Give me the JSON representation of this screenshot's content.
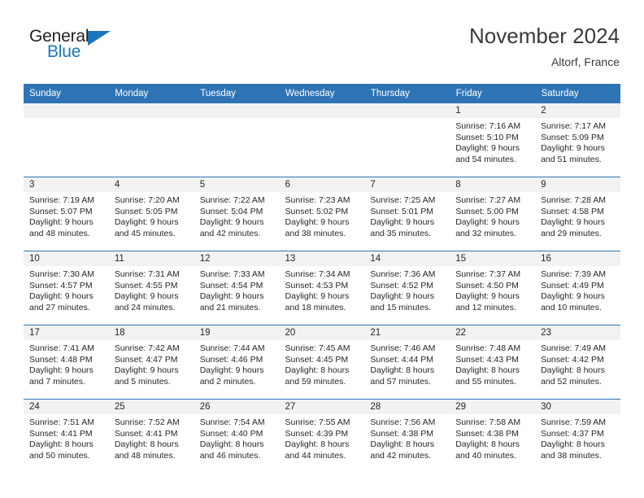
{
  "brand": {
    "name_top": "General",
    "name_bottom": "Blue",
    "triangle_icon": "triangle-icon",
    "color_blue": "#1b75bc",
    "color_dark": "#231f20"
  },
  "header": {
    "title": "November 2024",
    "location": "Altorf, France"
  },
  "theme": {
    "header_blue": "#2e74b5",
    "daynum_band": "#f2f2f2",
    "text": "#262626"
  },
  "weekdays": [
    "Sunday",
    "Monday",
    "Tuesday",
    "Wednesday",
    "Thursday",
    "Friday",
    "Saturday"
  ],
  "labels": {
    "sunrise_prefix": "Sunrise:",
    "sunset_prefix": "Sunset:",
    "daylight_prefix": "Daylight:"
  },
  "weeks": [
    [
      {
        "day": "",
        "sunrise": "",
        "sunset": "",
        "daylight_line1": "",
        "daylight_line2": ""
      },
      {
        "day": "",
        "sunrise": "",
        "sunset": "",
        "daylight_line1": "",
        "daylight_line2": ""
      },
      {
        "day": "",
        "sunrise": "",
        "sunset": "",
        "daylight_line1": "",
        "daylight_line2": ""
      },
      {
        "day": "",
        "sunrise": "",
        "sunset": "",
        "daylight_line1": "",
        "daylight_line2": ""
      },
      {
        "day": "",
        "sunrise": "",
        "sunset": "",
        "daylight_line1": "",
        "daylight_line2": ""
      },
      {
        "day": "1",
        "sunrise": "Sunrise: 7:16 AM",
        "sunset": "Sunset: 5:10 PM",
        "daylight_line1": "Daylight: 9 hours",
        "daylight_line2": "and 54 minutes."
      },
      {
        "day": "2",
        "sunrise": "Sunrise: 7:17 AM",
        "sunset": "Sunset: 5:09 PM",
        "daylight_line1": "Daylight: 9 hours",
        "daylight_line2": "and 51 minutes."
      }
    ],
    [
      {
        "day": "3",
        "sunrise": "Sunrise: 7:19 AM",
        "sunset": "Sunset: 5:07 PM",
        "daylight_line1": "Daylight: 9 hours",
        "daylight_line2": "and 48 minutes."
      },
      {
        "day": "4",
        "sunrise": "Sunrise: 7:20 AM",
        "sunset": "Sunset: 5:05 PM",
        "daylight_line1": "Daylight: 9 hours",
        "daylight_line2": "and 45 minutes."
      },
      {
        "day": "5",
        "sunrise": "Sunrise: 7:22 AM",
        "sunset": "Sunset: 5:04 PM",
        "daylight_line1": "Daylight: 9 hours",
        "daylight_line2": "and 42 minutes."
      },
      {
        "day": "6",
        "sunrise": "Sunrise: 7:23 AM",
        "sunset": "Sunset: 5:02 PM",
        "daylight_line1": "Daylight: 9 hours",
        "daylight_line2": "and 38 minutes."
      },
      {
        "day": "7",
        "sunrise": "Sunrise: 7:25 AM",
        "sunset": "Sunset: 5:01 PM",
        "daylight_line1": "Daylight: 9 hours",
        "daylight_line2": "and 35 minutes."
      },
      {
        "day": "8",
        "sunrise": "Sunrise: 7:27 AM",
        "sunset": "Sunset: 5:00 PM",
        "daylight_line1": "Daylight: 9 hours",
        "daylight_line2": "and 32 minutes."
      },
      {
        "day": "9",
        "sunrise": "Sunrise: 7:28 AM",
        "sunset": "Sunset: 4:58 PM",
        "daylight_line1": "Daylight: 9 hours",
        "daylight_line2": "and 29 minutes."
      }
    ],
    [
      {
        "day": "10",
        "sunrise": "Sunrise: 7:30 AM",
        "sunset": "Sunset: 4:57 PM",
        "daylight_line1": "Daylight: 9 hours",
        "daylight_line2": "and 27 minutes."
      },
      {
        "day": "11",
        "sunrise": "Sunrise: 7:31 AM",
        "sunset": "Sunset: 4:55 PM",
        "daylight_line1": "Daylight: 9 hours",
        "daylight_line2": "and 24 minutes."
      },
      {
        "day": "12",
        "sunrise": "Sunrise: 7:33 AM",
        "sunset": "Sunset: 4:54 PM",
        "daylight_line1": "Daylight: 9 hours",
        "daylight_line2": "and 21 minutes."
      },
      {
        "day": "13",
        "sunrise": "Sunrise: 7:34 AM",
        "sunset": "Sunset: 4:53 PM",
        "daylight_line1": "Daylight: 9 hours",
        "daylight_line2": "and 18 minutes."
      },
      {
        "day": "14",
        "sunrise": "Sunrise: 7:36 AM",
        "sunset": "Sunset: 4:52 PM",
        "daylight_line1": "Daylight: 9 hours",
        "daylight_line2": "and 15 minutes."
      },
      {
        "day": "15",
        "sunrise": "Sunrise: 7:37 AM",
        "sunset": "Sunset: 4:50 PM",
        "daylight_line1": "Daylight: 9 hours",
        "daylight_line2": "and 12 minutes."
      },
      {
        "day": "16",
        "sunrise": "Sunrise: 7:39 AM",
        "sunset": "Sunset: 4:49 PM",
        "daylight_line1": "Daylight: 9 hours",
        "daylight_line2": "and 10 minutes."
      }
    ],
    [
      {
        "day": "17",
        "sunrise": "Sunrise: 7:41 AM",
        "sunset": "Sunset: 4:48 PM",
        "daylight_line1": "Daylight: 9 hours",
        "daylight_line2": "and 7 minutes."
      },
      {
        "day": "18",
        "sunrise": "Sunrise: 7:42 AM",
        "sunset": "Sunset: 4:47 PM",
        "daylight_line1": "Daylight: 9 hours",
        "daylight_line2": "and 5 minutes."
      },
      {
        "day": "19",
        "sunrise": "Sunrise: 7:44 AM",
        "sunset": "Sunset: 4:46 PM",
        "daylight_line1": "Daylight: 9 hours",
        "daylight_line2": "and 2 minutes."
      },
      {
        "day": "20",
        "sunrise": "Sunrise: 7:45 AM",
        "sunset": "Sunset: 4:45 PM",
        "daylight_line1": "Daylight: 8 hours",
        "daylight_line2": "and 59 minutes."
      },
      {
        "day": "21",
        "sunrise": "Sunrise: 7:46 AM",
        "sunset": "Sunset: 4:44 PM",
        "daylight_line1": "Daylight: 8 hours",
        "daylight_line2": "and 57 minutes."
      },
      {
        "day": "22",
        "sunrise": "Sunrise: 7:48 AM",
        "sunset": "Sunset: 4:43 PM",
        "daylight_line1": "Daylight: 8 hours",
        "daylight_line2": "and 55 minutes."
      },
      {
        "day": "23",
        "sunrise": "Sunrise: 7:49 AM",
        "sunset": "Sunset: 4:42 PM",
        "daylight_line1": "Daylight: 8 hours",
        "daylight_line2": "and 52 minutes."
      }
    ],
    [
      {
        "day": "24",
        "sunrise": "Sunrise: 7:51 AM",
        "sunset": "Sunset: 4:41 PM",
        "daylight_line1": "Daylight: 8 hours",
        "daylight_line2": "and 50 minutes."
      },
      {
        "day": "25",
        "sunrise": "Sunrise: 7:52 AM",
        "sunset": "Sunset: 4:41 PM",
        "daylight_line1": "Daylight: 8 hours",
        "daylight_line2": "and 48 minutes."
      },
      {
        "day": "26",
        "sunrise": "Sunrise: 7:54 AM",
        "sunset": "Sunset: 4:40 PM",
        "daylight_line1": "Daylight: 8 hours",
        "daylight_line2": "and 46 minutes."
      },
      {
        "day": "27",
        "sunrise": "Sunrise: 7:55 AM",
        "sunset": "Sunset: 4:39 PM",
        "daylight_line1": "Daylight: 8 hours",
        "daylight_line2": "and 44 minutes."
      },
      {
        "day": "28",
        "sunrise": "Sunrise: 7:56 AM",
        "sunset": "Sunset: 4:38 PM",
        "daylight_line1": "Daylight: 8 hours",
        "daylight_line2": "and 42 minutes."
      },
      {
        "day": "29",
        "sunrise": "Sunrise: 7:58 AM",
        "sunset": "Sunset: 4:38 PM",
        "daylight_line1": "Daylight: 8 hours",
        "daylight_line2": "and 40 minutes."
      },
      {
        "day": "30",
        "sunrise": "Sunrise: 7:59 AM",
        "sunset": "Sunset: 4:37 PM",
        "daylight_line1": "Daylight: 8 hours",
        "daylight_line2": "and 38 minutes."
      }
    ]
  ]
}
